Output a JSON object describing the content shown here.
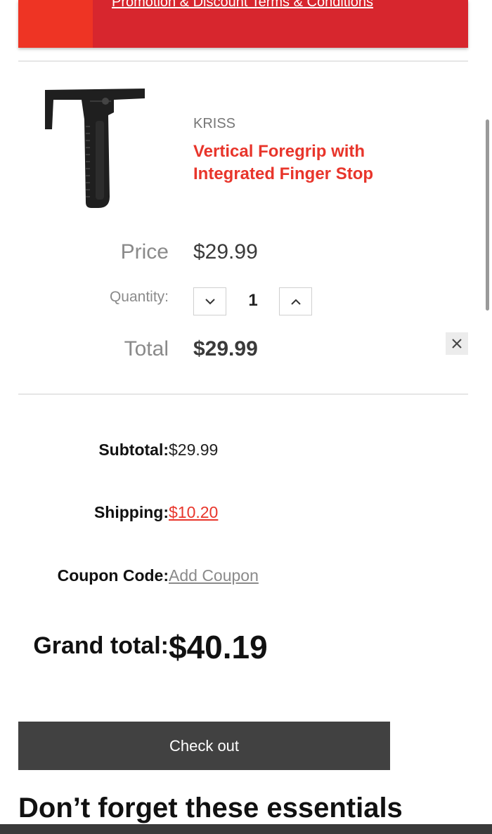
{
  "banner": {
    "link_text": "Promotion & Discount Terms & Conditions"
  },
  "cart_item": {
    "brand": "KRISS",
    "title": "Vertical Foregrip with Integrated Finger Stop",
    "price_label": "Price",
    "price": "$29.99",
    "quantity_label": "Quantity:",
    "quantity": "1",
    "total_label": "Total",
    "total": "$29.99",
    "icons": {
      "decrease": "chevron-down-icon",
      "increase": "chevron-up-icon",
      "remove": "close-icon"
    }
  },
  "summary": {
    "subtotal_label": "Subtotal:",
    "subtotal": "$29.99",
    "shipping_label": "Shipping:",
    "shipping": "$10.20",
    "coupon_label": "Coupon Code:",
    "coupon_link": "Add Coupon",
    "grand_total_label": "Grand total:",
    "grand_total": "$40.19"
  },
  "checkout": {
    "button_label": "Check out"
  },
  "recommendations": {
    "heading": "Don’t forget these essentials"
  },
  "colors": {
    "brand_red": "#e8352b",
    "banner_red": "#d7262e",
    "button_dark": "#414141"
  }
}
